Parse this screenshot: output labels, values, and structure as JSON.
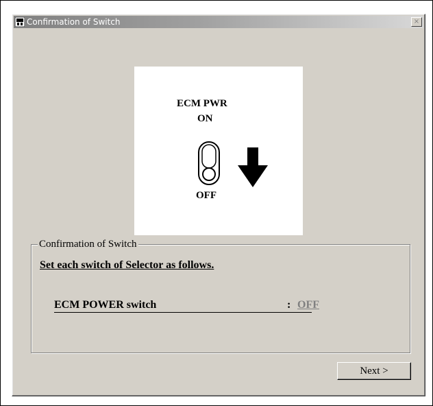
{
  "window": {
    "title": "Confirmation of Switch",
    "close_glyph": "×"
  },
  "illustration": {
    "switch_name_line1": "ECM PWR",
    "switch_name_line2": "ON",
    "off_label": "OFF",
    "arrow_direction": "down"
  },
  "group": {
    "label": "Confirmation of Switch",
    "instruction": "Set each switch of Selector as follows.",
    "switch_name": "ECM POWER switch",
    "separator": ":",
    "switch_value": "OFF"
  },
  "buttons": {
    "next_label": "Next >"
  },
  "colors": {
    "dialog_bg": "#d4d0c8",
    "title_gradient_start": "#808080",
    "title_gradient_end": "#d8d8d8",
    "value_text": "#808080"
  }
}
